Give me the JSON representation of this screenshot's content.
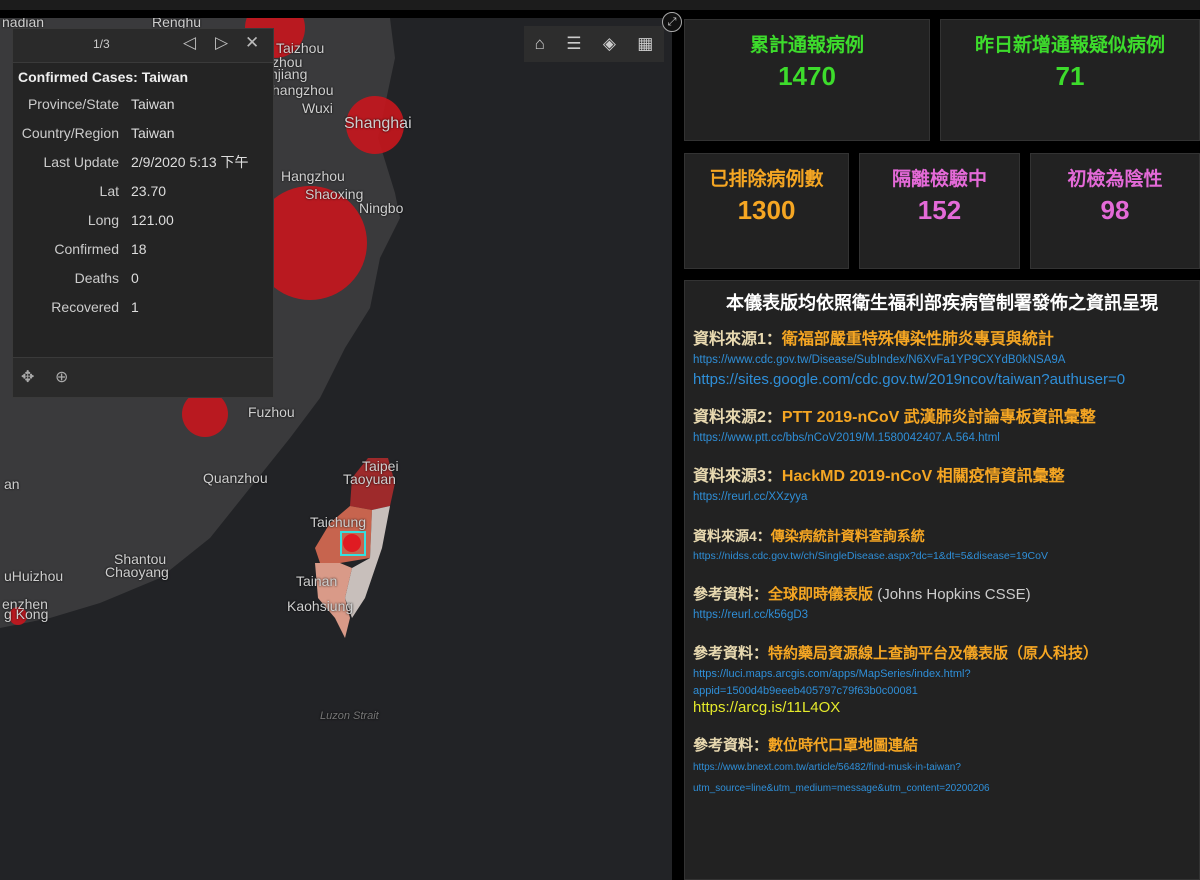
{
  "map": {
    "labels": [
      "nadian",
      "Renghu",
      "Taizhou",
      "zhou",
      "njiang",
      "hangzhou",
      "Wuxi",
      "Shanghai",
      "Hangzhou",
      "Shaoxing",
      "Ningbo",
      "Fuzhou",
      "Quanzhou",
      "an",
      "Taipei",
      "Taoyuan",
      "Taichung",
      "Tainan",
      "Kaohsiung",
      "Shantou",
      "Chaoyang",
      "uHuizhou",
      "enzhen",
      "g Kong",
      "Luzon Strait"
    ],
    "popup": {
      "pager": "1/3",
      "title": "Confirmed Cases: Taiwan",
      "fields": [
        {
          "k": "Province/State",
          "v": "Taiwan"
        },
        {
          "k": "Country/Region",
          "v": "Taiwan"
        },
        {
          "k": "Last Update",
          "v": "2/9/2020 5:13 下午"
        },
        {
          "k": "Lat",
          "v": "23.70"
        },
        {
          "k": "Long",
          "v": "121.00"
        },
        {
          "k": "Confirmed",
          "v": "18"
        },
        {
          "k": "Deaths",
          "v": "0"
        },
        {
          "k": "Recovered",
          "v": "1"
        }
      ]
    }
  },
  "stats": [
    {
      "label": "累計通報病例",
      "value": "1470",
      "color": "#3ddc2c"
    },
    {
      "label": "昨日新增通報疑似病例",
      "value": "71",
      "color": "#3ddc2c"
    },
    {
      "label": "已排除病例數",
      "value": "1300",
      "color": "#f5a623"
    },
    {
      "label": "隔離檢驗中",
      "value": "152",
      "color": "#e46ad8"
    },
    {
      "label": "初檢為陰性",
      "value": "98",
      "color": "#e46ad8"
    }
  ],
  "info": {
    "heading": "本儀表版均依照衛生福利部疾病管制署發佈之資訊呈現",
    "s1": {
      "prefix": "資料來源1：",
      "title": "衛福部嚴重特殊傳染性肺炎專頁與統計",
      "url1": "https://www.cdc.gov.tw/Disease/SubIndex/N6XvFa1YP9CXYdB0kNSA9A",
      "url2": "https://sites.google.com/cdc.gov.tw/2019ncov/taiwan?authuser=0"
    },
    "s2": {
      "prefix": "資料來源2：",
      "title": "PTT 2019-nCoV 武漢肺炎討論專板資訊彙整",
      "url1": "https://www.ptt.cc/bbs/nCoV2019/M.1580042407.A.564.html"
    },
    "s3": {
      "prefix": "資料來源3：",
      "title": "HackMD 2019-nCoV 相關疫情資訊彙整",
      "url1": "https://reurl.cc/XXzyya"
    },
    "s4": {
      "prefix": "資料來源4：",
      "title": "傳染病統計資料查詢系統",
      "url1": "https://nidss.cdc.gov.tw/ch/SingleDisease.aspx?dc=1&dt=5&disease=19CoV"
    },
    "r1": {
      "prefix": "參考資料：",
      "title": "全球即時儀表版",
      "extra": "(Johns Hopkins CSSE)",
      "url1": "https://reurl.cc/k56gD3"
    },
    "r2": {
      "prefix": "參考資料：",
      "title": "特約藥局資源線上查詢平台及儀表版（原人科技）",
      "url1": "https://luci.maps.arcgis.com/apps/MapSeries/index.html?",
      "url2": "appid=1500d4b9eeeb405797c79f63b0c00081",
      "url3": "https://arcg.is/11L4OX"
    },
    "r3": {
      "prefix": "參考資料：",
      "title": "數位時代口罩地圖連結",
      "url1": "https://www.bnext.com.tw/article/56482/find-musk-in-taiwan?",
      "url2": "utm_source=line&utm_medium=message&utm_content=20200206"
    }
  }
}
